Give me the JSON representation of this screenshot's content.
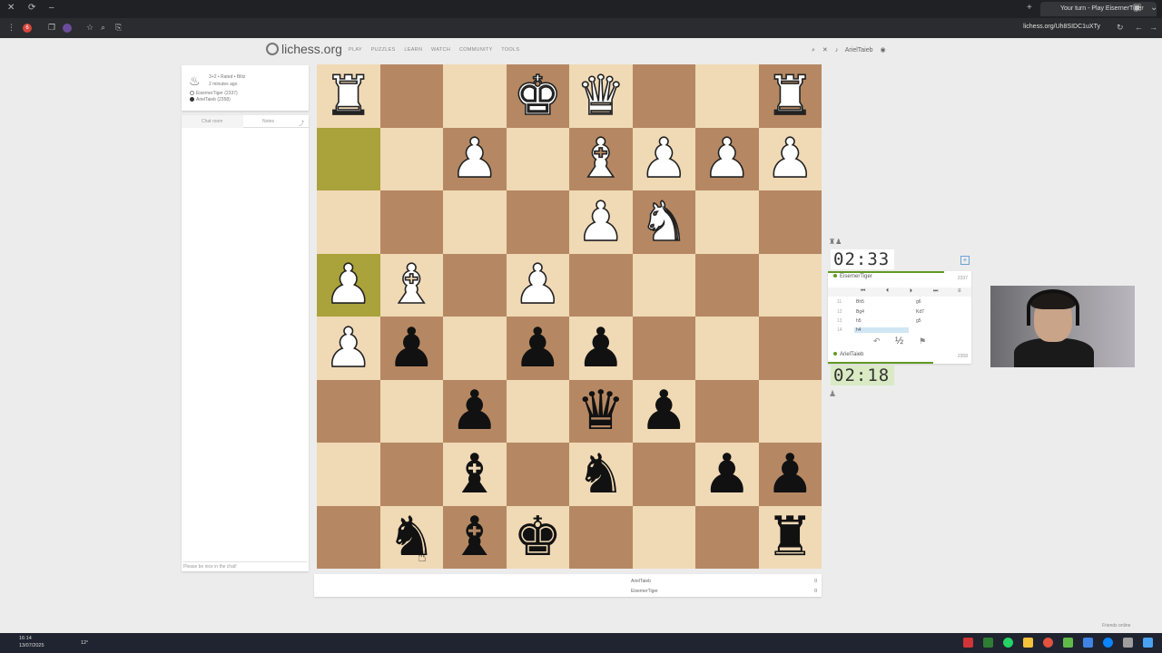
{
  "browser": {
    "tab_title": "Your turn - Play EisernerTiger",
    "address": "lichess.org/Uh8SIDC1uXTy",
    "notif_count": "6"
  },
  "site": {
    "logo": "lichess.org",
    "nav": [
      "PLAY",
      "PUZZLES",
      "LEARN",
      "WATCH",
      "COMMUNITY",
      "TOOLS"
    ],
    "username": "ArielTaieb"
  },
  "game_info": {
    "mode": "3+2 • Rated • Blitz",
    "time_ago": "2 minutes ago",
    "white_player": "EisernerTiger (2337)",
    "black_player": "ArielTaieb (2358)"
  },
  "chat": {
    "tab_chat": "Chat room",
    "tab_notes": "Notes",
    "placeholder": "Please be nice in the chat!"
  },
  "board": {
    "highlight": [
      [
        1,
        0
      ],
      [
        3,
        0
      ]
    ],
    "squares": [
      [
        "wR",
        "",
        "",
        "wK",
        "wQ",
        "",
        "",
        "wR"
      ],
      [
        "",
        "",
        "wP",
        "",
        "wB",
        "wP",
        "wP",
        "wP"
      ],
      [
        "",
        "",
        "",
        "",
        "wP",
        "wN",
        "",
        ""
      ],
      [
        "wP",
        "wB",
        "",
        "wP",
        "",
        "",
        "",
        ""
      ],
      [
        "wP",
        "bP",
        "",
        "bP",
        "bP",
        "",
        "",
        ""
      ],
      [
        "",
        "",
        "bP",
        "",
        "bQ",
        "bP",
        "",
        ""
      ],
      [
        "",
        "",
        "bB",
        "",
        "bN",
        "",
        "bP",
        "bP"
      ],
      [
        "",
        "bN",
        "bB",
        "bK",
        "",
        "",
        "",
        "bR"
      ]
    ]
  },
  "clocks": {
    "top": "02:33",
    "bottom": "02:18"
  },
  "players": {
    "top_name": "EisernerTiger",
    "top_rating": "2337",
    "bottom_name": "ArielTaieb",
    "bottom_rating": "2358"
  },
  "moves": [
    {
      "n": "11",
      "w": "Bh5",
      "b": "g6"
    },
    {
      "n": "12",
      "w": "Bg4",
      "b": "Kd7"
    },
    {
      "n": "13",
      "w": "h5",
      "b": "g5"
    },
    {
      "n": "14",
      "w": "h4",
      "b": ""
    }
  ],
  "actions": {
    "draw": "½"
  },
  "underboard": {
    "rows": [
      {
        "name": "ArielTaieb",
        "value": "0"
      },
      {
        "name": "EisernerTiger",
        "value": "0"
      }
    ]
  },
  "friends": "Friends online",
  "taskbar": {
    "time": "16:14",
    "date": "13/07/2025",
    "temp": "12°"
  }
}
